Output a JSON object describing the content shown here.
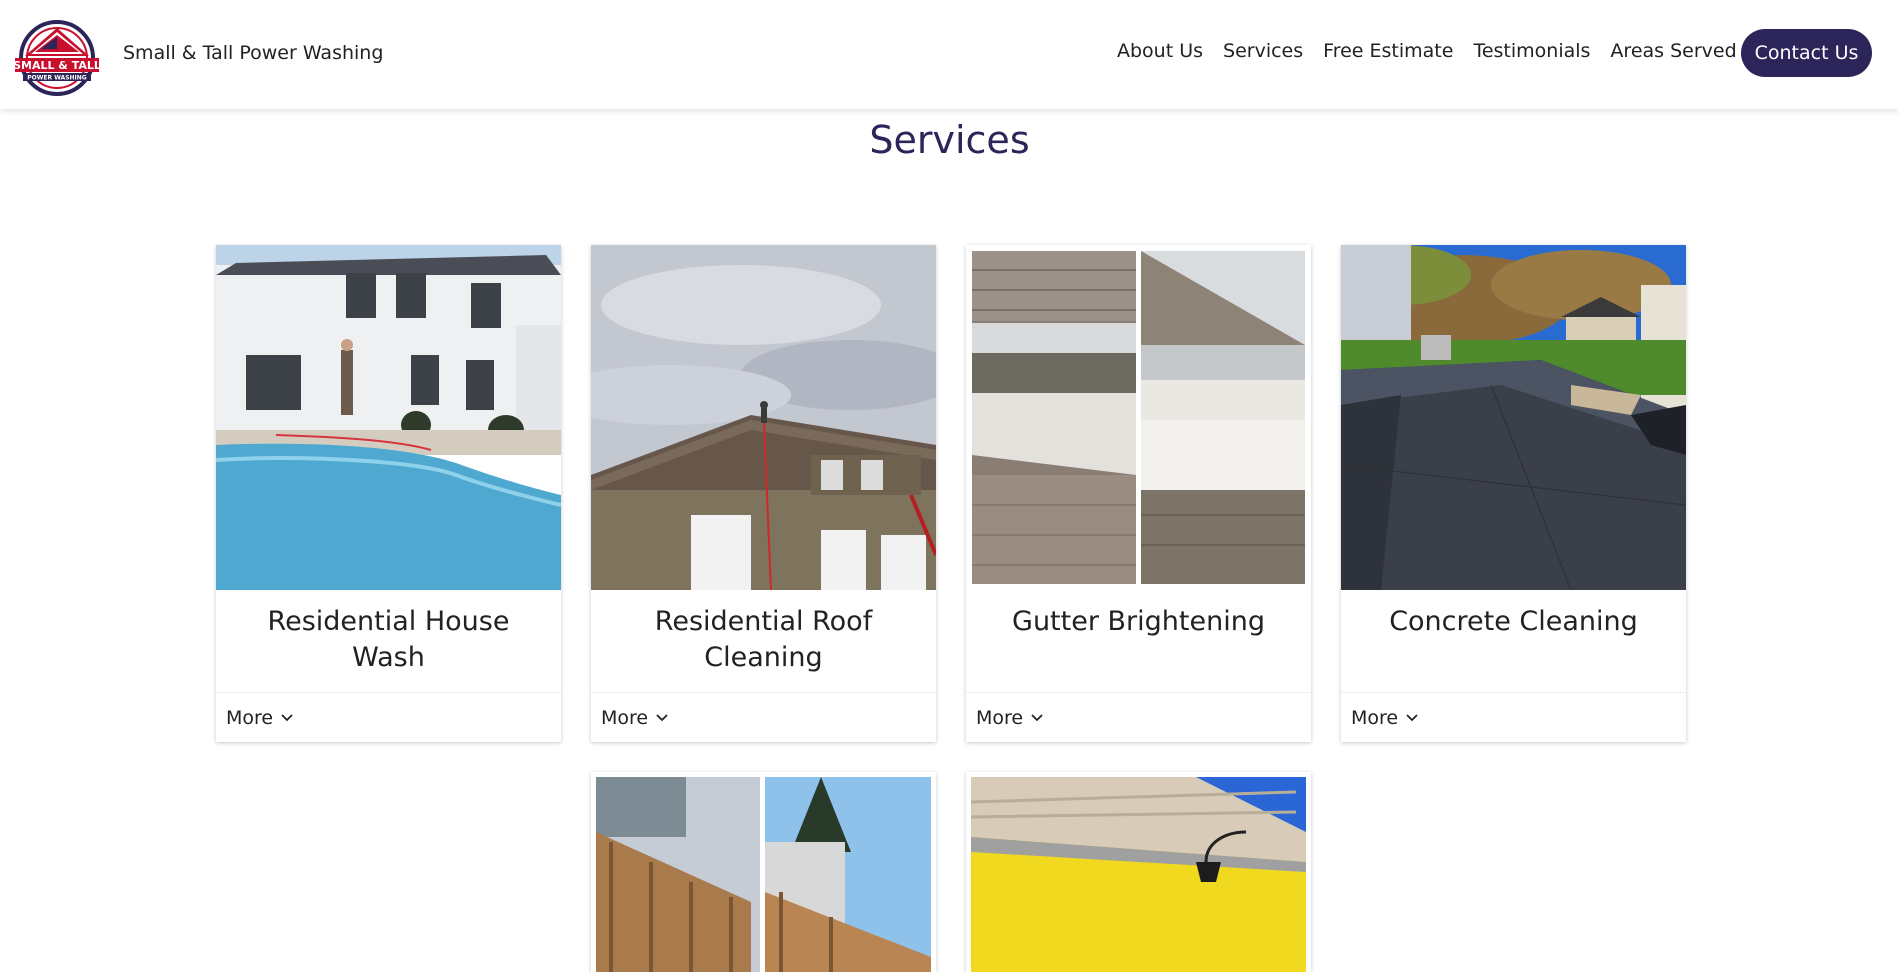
{
  "header": {
    "brand_name": "Small & Tall Power Washing",
    "logo": {
      "line1": "SMALL & TALL",
      "line2": "POWER WASHING"
    },
    "nav": [
      "About Us",
      "Services",
      "Free Estimate",
      "Testimonials",
      "Areas Served"
    ],
    "contact_label": "Contact Us"
  },
  "main": {
    "title": "Services",
    "more_label": "More",
    "cards": [
      {
        "title": "Residential House Wash",
        "icon": "chevron-down-icon"
      },
      {
        "title": "Residential Roof Cleaning",
        "icon": "chevron-down-icon"
      },
      {
        "title": "Gutter Brightening",
        "icon": "chevron-down-icon"
      },
      {
        "title": "Concrete Cleaning",
        "icon": "chevron-down-icon"
      }
    ]
  },
  "colors": {
    "brand": "#2b2559",
    "button_text": "#ffffff"
  }
}
